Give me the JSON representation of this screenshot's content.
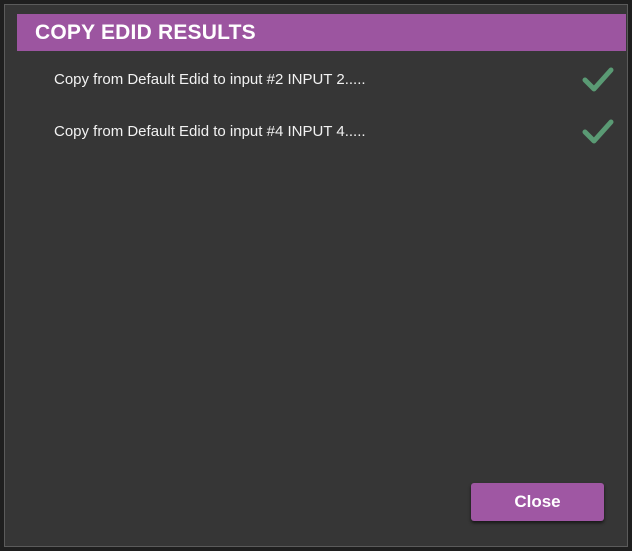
{
  "dialog": {
    "title": "COPY EDID RESULTS",
    "results": [
      {
        "text": "Copy from Default Edid to input #2 INPUT 2.....",
        "status_icon": "check-icon",
        "status": "success"
      },
      {
        "text": "Copy from Default Edid to input #4 INPUT 4.....",
        "status_icon": "check-icon",
        "status": "success"
      }
    ],
    "close_label": "Close"
  },
  "colors": {
    "accent": "#9c55a0",
    "background": "#363636",
    "success": "#5a9a74"
  }
}
